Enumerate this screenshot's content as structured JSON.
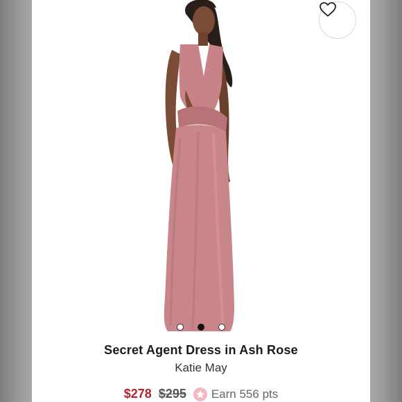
{
  "product": {
    "title": "Secret Agent Dress in Ash Rose",
    "brand": "Katie May",
    "price_sale": "$278",
    "price_original": "$295",
    "points_label": "Earn 556 pts"
  },
  "gallery": {
    "image_count": 3,
    "active_index": 1
  },
  "icons": {
    "wishlist": "heart-icon",
    "points": "star-icon"
  },
  "colors": {
    "sale_price": "#b0262d",
    "dress": "#c9868a",
    "points_badge": "#f4b8c1"
  }
}
